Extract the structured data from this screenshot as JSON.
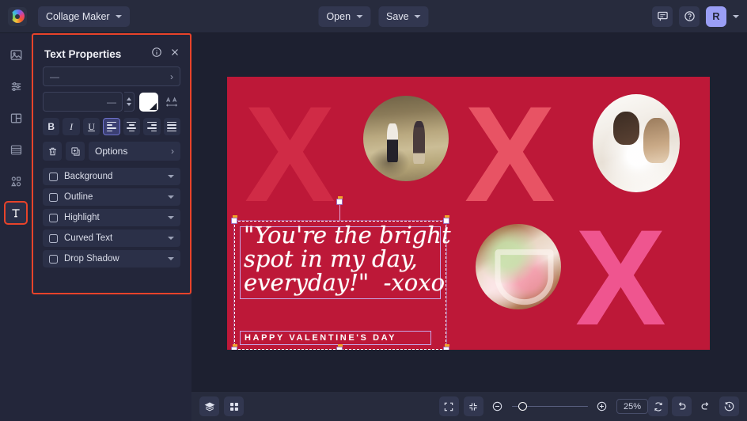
{
  "topbar": {
    "logo_icon": "colorwheel-logo-icon",
    "project_title": "Collage Maker",
    "project_chevron_icon": "chevron-down-icon",
    "open_label": "Open",
    "open_chevron_icon": "chevron-down-icon",
    "save_label": "Save",
    "save_chevron_icon": "chevron-down-icon",
    "feedback_icon": "chat-bubble-icon",
    "help_icon": "question-circle-icon",
    "avatar_initial": "R",
    "avatar_chevron_icon": "chevron-down-icon"
  },
  "sidebar": {
    "items": [
      {
        "name": "sidebar-item-photos",
        "icon": "image-icon",
        "active": false
      },
      {
        "name": "sidebar-item-adjust",
        "icon": "sliders-icon",
        "active": false
      },
      {
        "name": "sidebar-item-layout",
        "icon": "layout-grid-icon",
        "active": false
      },
      {
        "name": "sidebar-item-background",
        "icon": "layers-stack-icon",
        "active": false
      },
      {
        "name": "sidebar-item-graphics",
        "icon": "shapes-icon",
        "active": false
      },
      {
        "name": "sidebar-item-text",
        "icon": "text-t-icon",
        "active": true
      }
    ]
  },
  "panel": {
    "title": "Text Properties",
    "info_icon": "info-circle-icon",
    "close_icon": "close-x-icon",
    "font_family_value": "—",
    "font_family_arrow_icon": "chevron-right-icon",
    "font_size_value": "—",
    "stepper_up_icon": "chevron-up-icon",
    "stepper_down_icon": "chevron-down-icon",
    "color_swatch": "#ffffff",
    "color_swatch_name": "text-color-swatch",
    "letter_spacing_icon": "letter-spacing-aa-icon",
    "format_buttons": [
      {
        "name": "bold-button",
        "label": "B",
        "active": false
      },
      {
        "name": "italic-button",
        "label": "I",
        "active": false
      },
      {
        "name": "underline-button",
        "label": "U",
        "active": false
      }
    ],
    "align_buttons": [
      {
        "name": "align-left-button",
        "icon": "align-left-icon",
        "active": true
      },
      {
        "name": "align-center-button",
        "icon": "align-center-icon",
        "active": false
      },
      {
        "name": "align-right-button",
        "icon": "align-right-icon",
        "active": false
      },
      {
        "name": "align-justify-button",
        "icon": "align-justify-icon",
        "active": false
      }
    ],
    "delete_icon": "trash-icon",
    "duplicate_icon": "duplicate-icon",
    "options_label": "Options",
    "options_arrow_icon": "chevron-right-icon",
    "effects": [
      {
        "label": "Background",
        "checked": false,
        "chevron": "chevron-down-icon"
      },
      {
        "label": "Outline",
        "checked": false,
        "chevron": "chevron-down-icon"
      },
      {
        "label": "Highlight",
        "checked": false,
        "chevron": "chevron-down-icon"
      },
      {
        "label": "Curved Text",
        "checked": false,
        "chevron": "chevron-down-icon"
      },
      {
        "label": "Drop Shadow",
        "checked": false,
        "chevron": "chevron-down-icon"
      }
    ],
    "highlight_border_color": "#e8432a"
  },
  "canvas": {
    "background_color": "#bd1838",
    "x_marks": [
      {
        "name": "x-mark-top-left",
        "color": "#d02b46"
      },
      {
        "name": "x-mark-top-middle",
        "color": "#e85364"
      },
      {
        "name": "x-mark-bottom-right",
        "color": "#ef558f"
      }
    ],
    "photos": [
      {
        "name": "photo-couple-holding-hands"
      },
      {
        "name": "photo-couple-kissing"
      },
      {
        "name": "photo-hands-heart"
      }
    ],
    "script_line1": "\"You're the bright",
    "script_line2": "spot in my day,",
    "script_line3": "everyday!\"  -xoxo",
    "caption": "HAPPY VALENTINE'S DAY"
  },
  "bottombar": {
    "layers_icon": "layers-icon",
    "thumbnails_icon": "grid-thumbnails-icon",
    "fit_icon": "fit-to-screen-icon",
    "shrink_icon": "collapse-arrows-icon",
    "zoom_out_icon": "zoom-out-minus-icon",
    "zoom_in_icon": "zoom-in-plus-icon",
    "zoom_level": "25%",
    "reset_icon": "refresh-reset-icon",
    "undo_icon": "undo-arrow-icon",
    "redo_icon": "redo-arrow-icon",
    "history_icon": "history-clock-icon"
  }
}
